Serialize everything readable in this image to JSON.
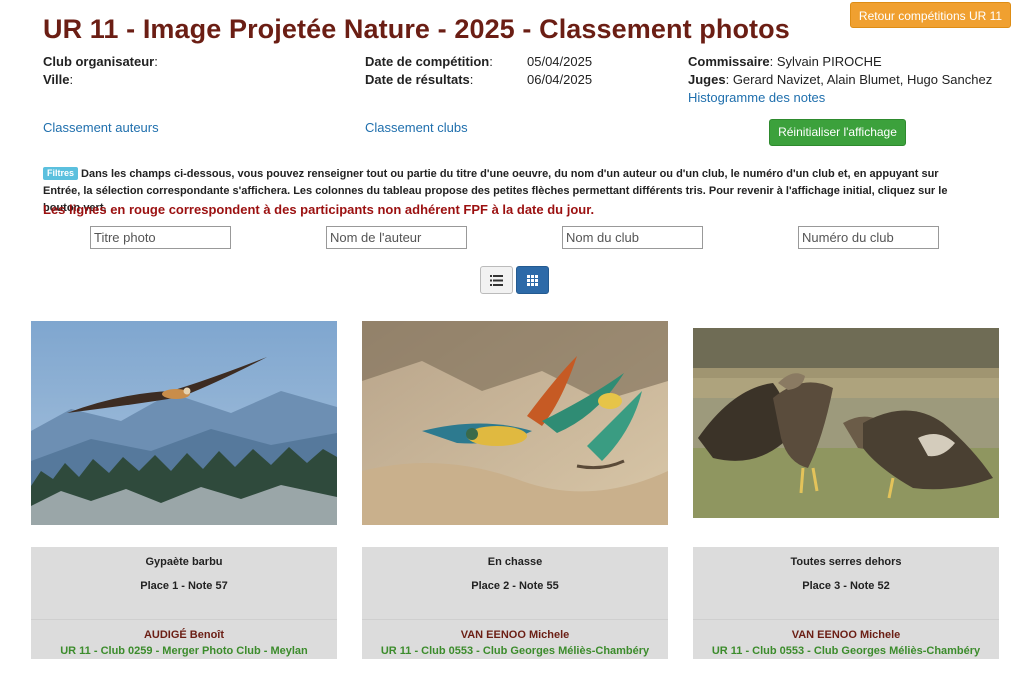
{
  "header": {
    "title": "UR 11 - Image Projetée Nature - 2025 - Classement photos",
    "back_button": "Retour compétitions UR 11"
  },
  "info": {
    "club_label": "Club organisateur",
    "ville_label": "Ville",
    "date_comp_label": "Date de compétition",
    "date_comp_value": "05/04/2025",
    "date_res_label": "Date de résultats",
    "date_res_value": "06/04/2025",
    "commissaire_label": "Commissaire",
    "commissaire_value": "Sylvain PIROCHE",
    "juges_label": "Juges",
    "juges_value": "Gerard Navizet, Alain Blumet, Hugo Sanchez",
    "histogram_link": "Histogramme des notes"
  },
  "nav": {
    "classement_auteurs": "Classement auteurs",
    "classement_clubs": "Classement clubs",
    "reset_button": "Réinitialiser l'affichage"
  },
  "filters": {
    "badge": "Filtres",
    "text": "Dans les champs ci-dessous, vous pouvez renseigner tout ou partie du titre d'une oeuvre, du nom d'un auteur ou d'un club, le numéro d'un club et, en appuyant sur Entrée, la sélection correspondante s'affichera. Les colonnes du tableau propose des petites flèches permettant différents tris. Pour revenir à l'affichage initial, cliquez sur le bouton vert.",
    "warning": "Les lignes en rouge correspondent à des participants non adhérent FPF à la date du jour.",
    "titre_placeholder": "Titre photo",
    "auteur_placeholder": "Nom de l'auteur",
    "club_placeholder": "Nom du club",
    "numero_placeholder": "Numéro du club"
  },
  "view_toggle": {
    "list_icon": "list-icon",
    "grid_icon": "grid-icon",
    "active": "grid"
  },
  "photos": [
    {
      "title": "Gypaète barbu",
      "place": "Place 1 - Note 57",
      "author": "AUDIGÉ Benoît",
      "club": "UR 11 - Club 0259 - Merger Photo Club - Meylan"
    },
    {
      "title": "En chasse",
      "place": "Place 2 - Note 55",
      "author": "VAN EENOO Michele",
      "club": "UR 11 - Club 0553 - Club Georges Méliès-Chambéry"
    },
    {
      "title": "Toutes serres dehors",
      "place": "Place 3 - Note 52",
      "author": "VAN EENOO Michele",
      "club": "UR 11 - Club 0553 - Club Georges Méliès-Chambéry"
    }
  ],
  "colors": {
    "title": "#6b1e14",
    "link": "#1f6fad",
    "orange_button": "#f0a030",
    "green_button": "#3ca13c",
    "warning": "#9b1010",
    "club_text": "#3c8c2c",
    "card_bg": "#dcdcdc"
  }
}
